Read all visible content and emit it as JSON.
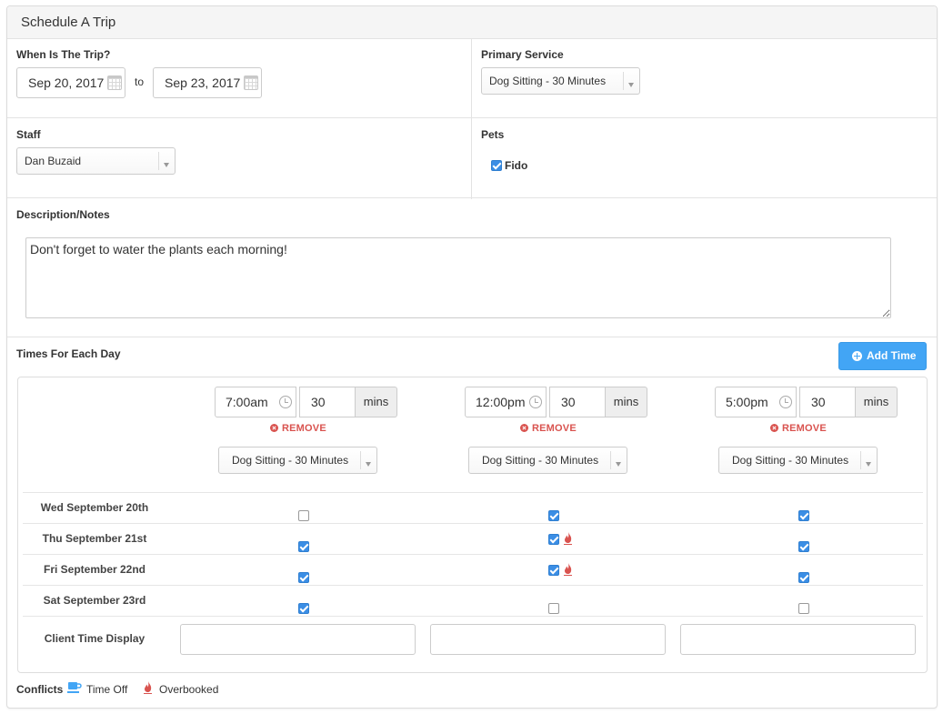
{
  "panel": {
    "title": "Schedule A Trip"
  },
  "trip": {
    "label": "When Is The Trip?",
    "start_date": "Sep 20, 2017",
    "to_label": "to",
    "end_date": "Sep 23, 2017"
  },
  "primary_service": {
    "label": "Primary Service",
    "value": "Dog Sitting - 30 Minutes"
  },
  "staff": {
    "label": "Staff",
    "value": "Dan Buzaid"
  },
  "pets": {
    "label": "Pets",
    "items": [
      {
        "name": "Fido",
        "checked": true
      }
    ]
  },
  "notes": {
    "label": "Description/Notes",
    "value": "Don't forget to water the plants each morning!"
  },
  "times": {
    "label": "Times For Each Day",
    "add_button": "Add Time",
    "remove_label": "REMOVE",
    "mins_label": "mins",
    "columns": [
      {
        "time": "7:00am",
        "duration": "30",
        "service": "Dog Sitting - 30 Minutes"
      },
      {
        "time": "12:00pm",
        "duration": "30",
        "service": "Dog Sitting - 30 Minutes"
      },
      {
        "time": "5:00pm",
        "duration": "30",
        "service": "Dog Sitting - 30 Minutes"
      }
    ],
    "days": [
      {
        "label": "Wed September 20th",
        "checks": [
          false,
          true,
          true
        ],
        "overbooked": [
          false,
          false,
          false
        ]
      },
      {
        "label": "Thu September 21st",
        "checks": [
          true,
          true,
          true
        ],
        "overbooked": [
          false,
          true,
          false
        ]
      },
      {
        "label": "Fri September 22nd",
        "checks": [
          true,
          true,
          true
        ],
        "overbooked": [
          false,
          true,
          false
        ]
      },
      {
        "label": "Sat September 23rd",
        "checks": [
          true,
          false,
          false
        ],
        "overbooked": [
          false,
          false,
          false
        ]
      }
    ],
    "client_time_label": "Client Time Display",
    "client_time_values": [
      "",
      "",
      ""
    ]
  },
  "conflicts": {
    "label": "Conflicts",
    "time_off": "Time Off",
    "overbooked": "Overbooked"
  },
  "colors": {
    "accent": "#42a5f5",
    "checkbox": "#3b8ee5",
    "danger": "#d9534f"
  },
  "icons": {
    "date": "calendar-icon",
    "time": "clock-icon",
    "remove": "x-circle-icon",
    "add": "plus-circle-icon",
    "overbooked": "flame-icon",
    "time_off": "coffee-cup-icon"
  }
}
